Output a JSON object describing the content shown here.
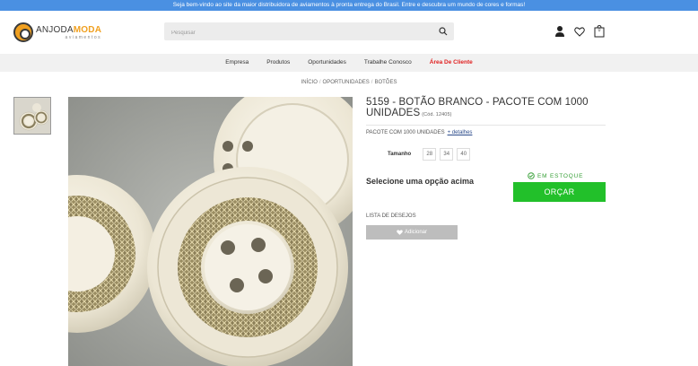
{
  "topbar": {
    "text": "Seja bem-vindo ao site da maior distribuidora de aviamentos à pronta entrega do Brasil. Entre e descubra um mundo de cores e formas!"
  },
  "brand": {
    "name_part1": "ANJODA",
    "name_part2": "MODA",
    "tagline": "aviamentos",
    "accent_color": "#f0a020"
  },
  "search": {
    "placeholder": "Pesquisar"
  },
  "header_icons": {
    "account": "user-icon",
    "wishlist": "heart-icon",
    "cart": "cart-icon",
    "cart_count": "0"
  },
  "nav": {
    "items": [
      "Empresa",
      "Produtos",
      "Oportunidades",
      "Trabalhe Conosco",
      "Área De Cliente"
    ]
  },
  "breadcrumb": {
    "items": [
      "INÍCIO",
      "OPORTUNIDADES",
      "BOTÕES"
    ]
  },
  "product": {
    "title": "5159 - BOTÃO BRANCO - PACOTE COM 1000 UNIDADES",
    "code": "(Cód. 12405)",
    "pack_text": "PACOTE COM 1000 UNIDADES",
    "details_link": "+ detalhes",
    "size_label": "Tamanho",
    "sizes": [
      "28",
      "34",
      "40"
    ],
    "select_msg": "Selecione uma opção acima",
    "stock": "EM ESTOQUE",
    "quote_button": "ORÇAR",
    "wishlist_label": "LISTA DE DESEJOS",
    "add_button": "Adicionar"
  },
  "colors": {
    "topbar": "#4a90e2",
    "quote_button": "#22c02a",
    "client_link": "#e02020",
    "stock": "#3aa13a"
  }
}
